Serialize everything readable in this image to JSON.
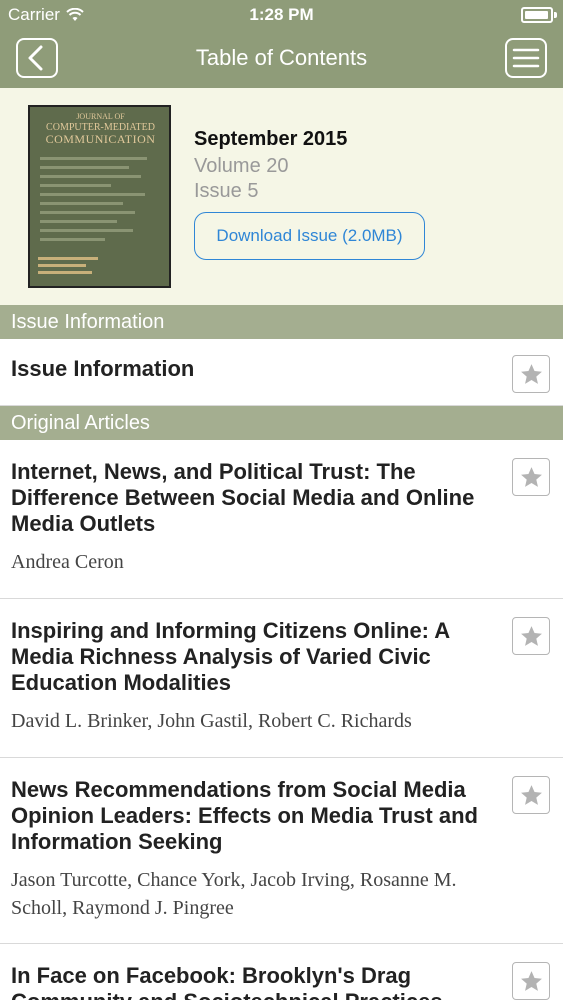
{
  "status_bar": {
    "carrier": "Carrier",
    "time": "1:28 PM",
    "battery_level": 0.95
  },
  "nav": {
    "title": "Table of Contents",
    "back_icon": "chevron-left-icon",
    "menu_icon": "hamburger-menu-icon"
  },
  "issue": {
    "cover": {
      "line1": "JOURNAL OF",
      "line2": "COMPUTER-MEDIATED",
      "line3": "COMMUNICATION"
    },
    "month": "September 2015",
    "volume": "Volume 20",
    "issue": "Issue 5",
    "download_label": "Download Issue (2.0MB)"
  },
  "sections": {
    "issue_info": {
      "header": "Issue Information",
      "item_title": "Issue Information"
    },
    "original_articles": {
      "header": "Original Articles"
    }
  },
  "articles": [
    {
      "title": "Internet, News, and Political Trust: The Difference Between Social Media and Online Media Outlets",
      "authors": "Andrea Ceron"
    },
    {
      "title": "Inspiring and Informing Citizens Online: A Media Richness Analysis of Varied Civic Education Modalities",
      "authors": "David L. Brinker, John Gastil, Robert C. Richards"
    },
    {
      "title": "News Recommendations from Social Media Opinion Leaders: Effects on Media Trust and Information Seeking",
      "authors": "Jason Turcotte, Chance York, Jacob Irving, Rosanne M. Scholl, Raymond J. Pingree"
    },
    {
      "title": "In Face on Facebook: Brooklyn's Drag Community and Sociotechnical Practices",
      "authors": ""
    }
  ],
  "colors": {
    "bar": "#8f9c79",
    "section": "#a4ae90",
    "header_bg": "#f5f6e6",
    "link": "#2f86d6"
  }
}
